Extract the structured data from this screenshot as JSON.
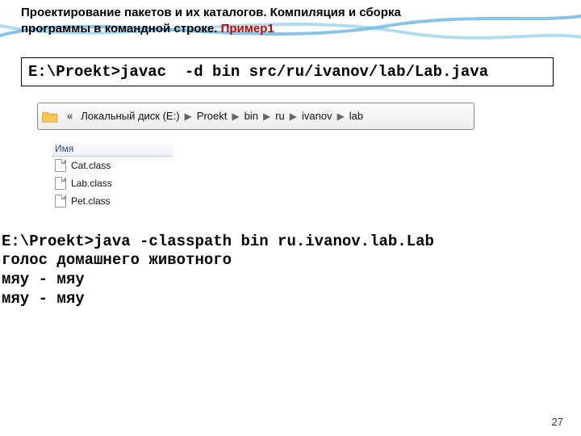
{
  "title": {
    "line1": "Проектирование пакетов и их каталогов. Компиляция и сборка",
    "line2_prefix": "программы в командной строке. ",
    "example": "Пример1"
  },
  "terminal_compile": "E:\\Proekt>javac  -d bin src/ru/ivanov/lab/Lab.java",
  "breadcrumb": {
    "chevrons": "«",
    "segments": [
      "Локальный диск (E:)",
      "Proekt",
      "bin",
      "ru",
      "ivanov",
      "lab"
    ]
  },
  "filelist": {
    "header": "Имя",
    "files": [
      "Cat.class",
      "Lab.class",
      "Pet.class"
    ]
  },
  "terminal_run": {
    "cmd": "E:\\Proekt>java -classpath bin ru.ivanov.lab.Lab",
    "out": [
      "голос домашнего животного",
      "мяу - мяу",
      "мяу - мяу"
    ]
  },
  "page_number": "27"
}
